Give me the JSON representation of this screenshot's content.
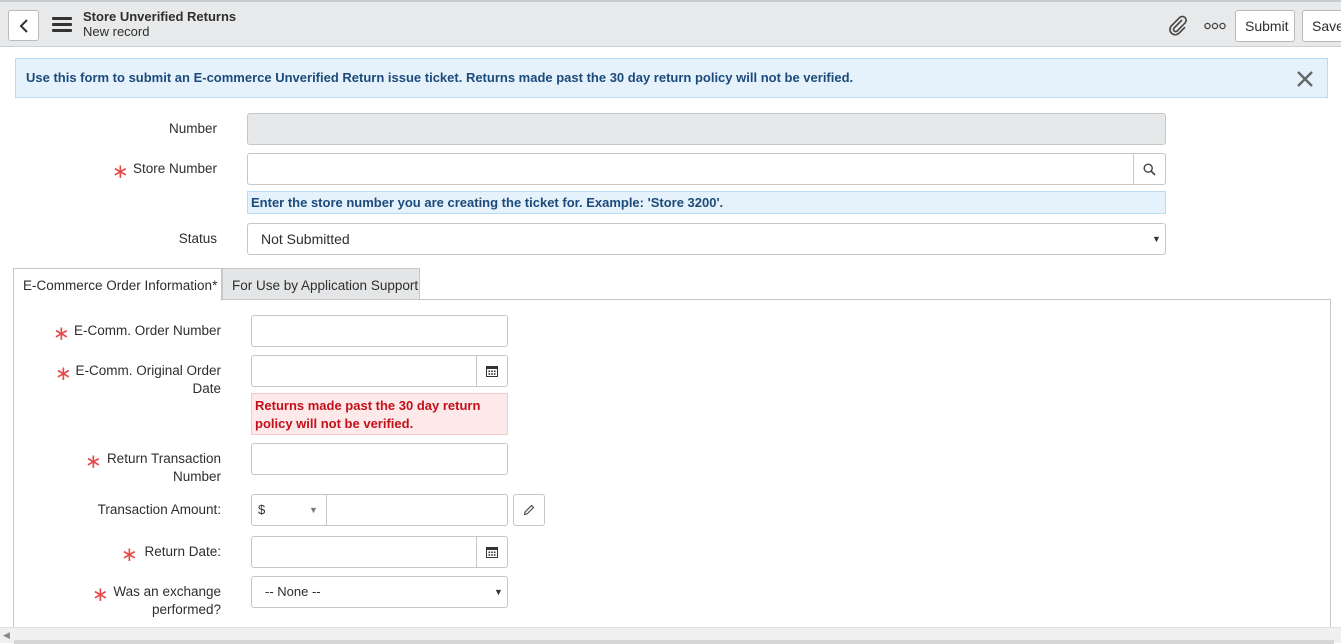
{
  "header": {
    "title": "Store Unverified Returns",
    "subtitle": "New record",
    "submit_label": "Submit",
    "save_label": "Save"
  },
  "banner": {
    "text": "Use this form to submit an E-commerce Unverified Return issue ticket. Returns made past the 30 day return policy will not be verified."
  },
  "form": {
    "number_label": "Number",
    "number_value": "",
    "store_number_label": "Store Number",
    "store_number_value": "",
    "store_number_hint": "Enter the store number you are creating the ticket for. Example: 'Store 3200'.",
    "status_label": "Status",
    "status_value": "Not Submitted"
  },
  "tabs": [
    {
      "label": "E-Commerce Order Information",
      "required_mark": "*",
      "active": true
    },
    {
      "label": "For Use by Application Support",
      "active": false
    }
  ],
  "order": {
    "order_number_label": "E-Comm. Order Number",
    "original_date_label_1": "E-Comm. Original Order",
    "original_date_label_2": "Date",
    "date_error": "Returns made past the 30 day return policy will not be verified.",
    "return_txn_label_1": "Return Transaction",
    "return_txn_label_2": "Number",
    "txn_amount_label": "Transaction Amount:",
    "currency_value": "$",
    "return_date_label": "Return Date:",
    "exchange_label_1": "Was an exchange",
    "exchange_label_2": "performed?",
    "exchange_value": "-- None --"
  },
  "required_mark": "∗",
  "colors": {
    "required": "#e54b4b",
    "info_bg": "#e5f2fc",
    "info_text": "#1c4a7a",
    "error_bg": "#fde9e9",
    "error_text": "#c3101a"
  }
}
